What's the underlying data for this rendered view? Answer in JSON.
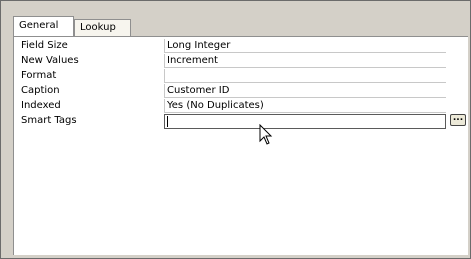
{
  "tabs": [
    {
      "label": "General",
      "active": true
    },
    {
      "label": "Lookup",
      "active": false
    }
  ],
  "properties": [
    {
      "label": "Field Size",
      "value": "Long Integer"
    },
    {
      "label": "New Values",
      "value": "Increment"
    },
    {
      "label": "Format",
      "value": ""
    },
    {
      "label": "Caption",
      "value": "Customer ID"
    },
    {
      "label": "Indexed",
      "value": "Yes (No Duplicates)"
    },
    {
      "label": "Smart Tags",
      "value": ""
    }
  ],
  "builder_button": {
    "label": "..."
  },
  "icons": {
    "pointer": "mouse-pointer-icon",
    "builder": "ellipsis-icon"
  },
  "colors": {
    "frame": "#d4d0c8",
    "panel": "#ffffff",
    "border": "#8f8f8f"
  }
}
